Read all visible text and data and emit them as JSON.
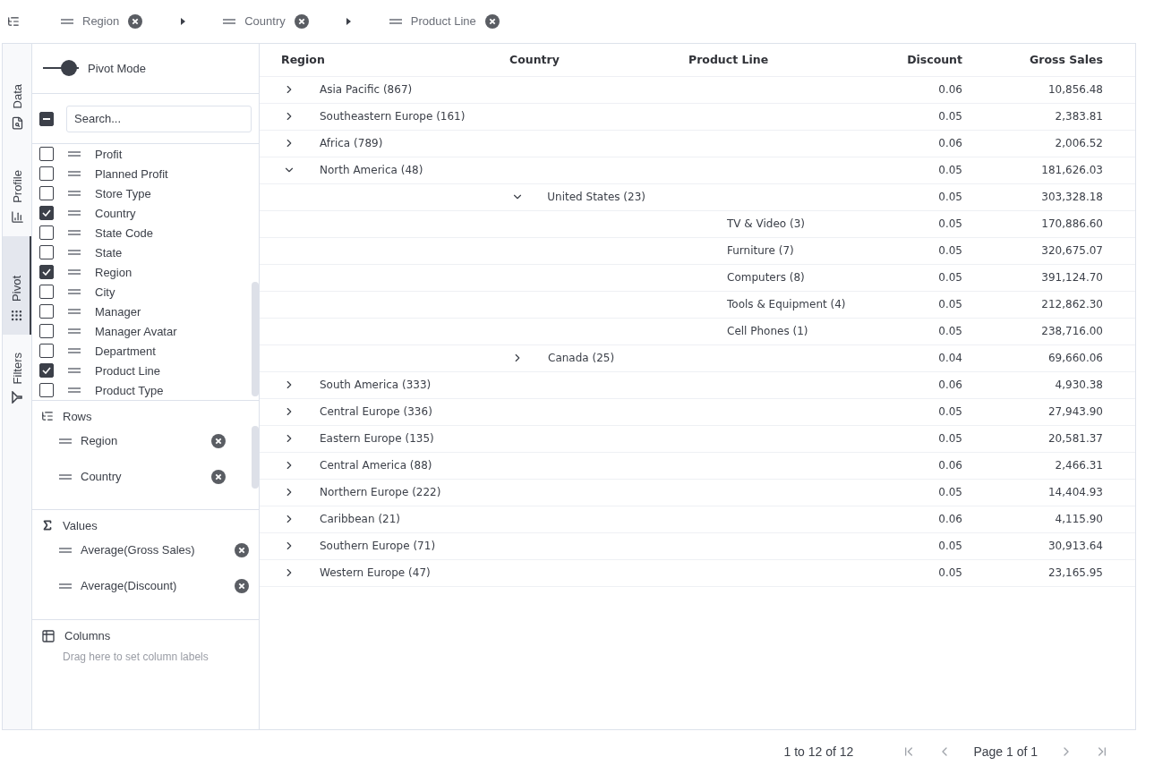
{
  "toolbar": {
    "chips": [
      {
        "label": "Region"
      },
      {
        "label": "Country"
      },
      {
        "label": "Product Line"
      }
    ]
  },
  "side_tabs": [
    {
      "label": "Data",
      "selected": false
    },
    {
      "label": "Profile",
      "selected": false
    },
    {
      "label": "Pivot",
      "selected": true
    },
    {
      "label": "Filters",
      "selected": false
    }
  ],
  "pivot_mode": {
    "label": "Pivot Mode",
    "on": true
  },
  "search": {
    "placeholder": "Search...",
    "indeterminate": true
  },
  "fields": [
    {
      "label": "Profit",
      "checked": false
    },
    {
      "label": "Planned Profit",
      "checked": false
    },
    {
      "label": "Store Type",
      "checked": false
    },
    {
      "label": "Country",
      "checked": true
    },
    {
      "label": "State Code",
      "checked": false
    },
    {
      "label": "State",
      "checked": false
    },
    {
      "label": "Region",
      "checked": true
    },
    {
      "label": "City",
      "checked": false
    },
    {
      "label": "Manager",
      "checked": false
    },
    {
      "label": "Manager Avatar",
      "checked": false
    },
    {
      "label": "Department",
      "checked": false
    },
    {
      "label": "Product Line",
      "checked": true
    },
    {
      "label": "Product Type",
      "checked": false
    }
  ],
  "zones": [
    {
      "kind": "rows",
      "title": "Rows",
      "items": [
        "Region",
        "Country"
      ]
    },
    {
      "kind": "values",
      "title": "Values",
      "items": [
        "Average(Gross Sales)",
        "Average(Discount)"
      ]
    },
    {
      "kind": "columns",
      "title": "Columns",
      "hint": "Drag here to set column labels"
    }
  ],
  "table": {
    "columns": [
      "Region",
      "Country",
      "Product Line",
      "Discount",
      "Gross Sales"
    ],
    "rows": [
      {
        "label": "Asia Pacific",
        "count": "(867)",
        "expanded": false,
        "discount": "0.06",
        "gross": "10,856.48"
      },
      {
        "label": "Southeastern Europe",
        "count": "(161)",
        "expanded": false,
        "discount": "0.05",
        "gross": "2,383.81"
      },
      {
        "label": "Africa",
        "count": "(789)",
        "expanded": false,
        "discount": "0.06",
        "gross": "2,006.52"
      },
      {
        "label": "North America",
        "count": "(48)",
        "expanded": true,
        "discount": "0.05",
        "gross": "181,626.03",
        "children": [
          {
            "label": "United States",
            "count": "(23)",
            "expanded": true,
            "discount": "0.05",
            "gross": "303,328.18",
            "children": [
              {
                "label": "TV & Video",
                "count": "(3)",
                "discount": "0.05",
                "gross": "170,886.60"
              },
              {
                "label": "Furniture",
                "count": "(7)",
                "discount": "0.05",
                "gross": "320,675.07"
              },
              {
                "label": "Computers",
                "count": "(8)",
                "discount": "0.05",
                "gross": "391,124.70"
              },
              {
                "label": "Tools & Equipment",
                "count": "(4)",
                "discount": "0.05",
                "gross": "212,862.30"
              },
              {
                "label": "Cell Phones",
                "count": "(1)",
                "discount": "0.05",
                "gross": "238,716.00"
              }
            ]
          },
          {
            "label": "Canada",
            "count": "(25)",
            "expanded": false,
            "discount": "0.04",
            "gross": "69,660.06"
          }
        ]
      },
      {
        "label": "South America",
        "count": "(333)",
        "expanded": false,
        "discount": "0.06",
        "gross": "4,930.38"
      },
      {
        "label": "Central Europe",
        "count": "(336)",
        "expanded": false,
        "discount": "0.05",
        "gross": "27,943.90"
      },
      {
        "label": "Eastern Europe",
        "count": "(135)",
        "expanded": false,
        "discount": "0.05",
        "gross": "20,581.37"
      },
      {
        "label": "Central America",
        "count": "(88)",
        "expanded": false,
        "discount": "0.06",
        "gross": "2,466.31"
      },
      {
        "label": "Northern Europe",
        "count": "(222)",
        "expanded": false,
        "discount": "0.05",
        "gross": "14,404.93"
      },
      {
        "label": "Caribbean",
        "count": "(21)",
        "expanded": false,
        "discount": "0.06",
        "gross": "4,115.90"
      },
      {
        "label": "Southern Europe",
        "count": "(71)",
        "expanded": false,
        "discount": "0.05",
        "gross": "30,913.64"
      },
      {
        "label": "Western Europe",
        "count": "(47)",
        "expanded": false,
        "discount": "0.05",
        "gross": "23,165.95"
      }
    ]
  },
  "pagination": {
    "summary": "1 to 12 of 12",
    "page": "Page 1 of 1"
  }
}
